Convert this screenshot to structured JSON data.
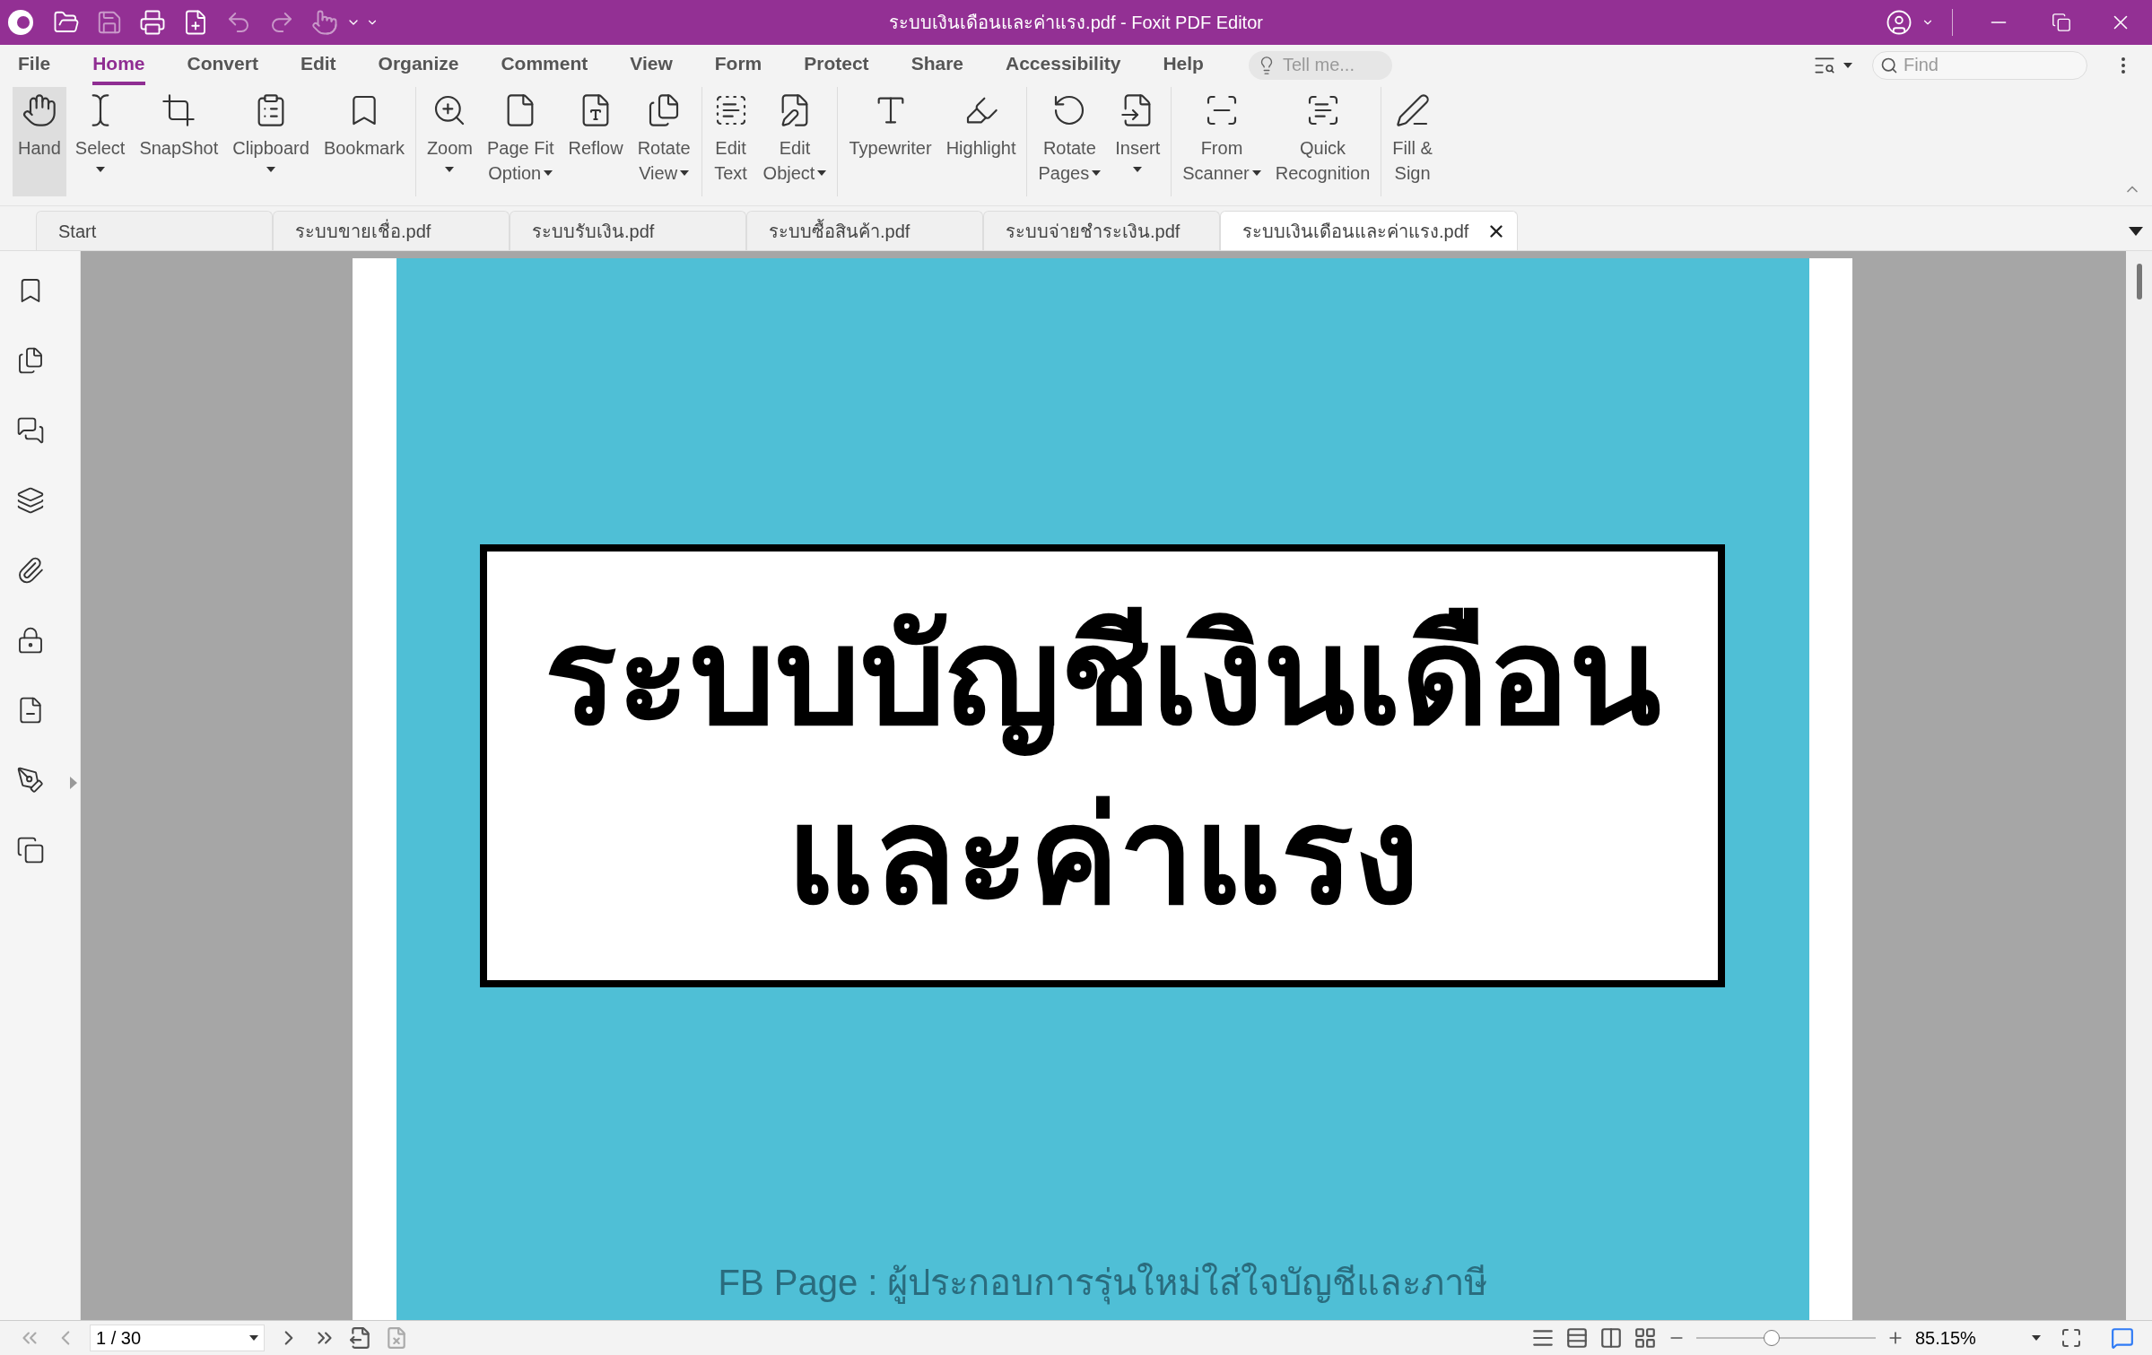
{
  "window": {
    "title": "ระบบเงินเดือนและค่าแรง.pdf - Foxit PDF Editor"
  },
  "menu": [
    {
      "label": "File",
      "selected": false
    },
    {
      "label": "Home",
      "selected": true
    },
    {
      "label": "Convert",
      "selected": false
    },
    {
      "label": "Edit",
      "selected": false
    },
    {
      "label": "Organize",
      "selected": false
    },
    {
      "label": "Comment",
      "selected": false
    },
    {
      "label": "View",
      "selected": false
    },
    {
      "label": "Form",
      "selected": false
    },
    {
      "label": "Protect",
      "selected": false
    },
    {
      "label": "Share",
      "selected": false
    },
    {
      "label": "Accessibility",
      "selected": false
    },
    {
      "label": "Help",
      "selected": false
    }
  ],
  "tell_me": {
    "placeholder": "Tell me..."
  },
  "find": {
    "placeholder": "Find"
  },
  "ribbon": [
    [
      {
        "lines": [
          "Hand"
        ],
        "dropdown": false,
        "selected": true
      },
      {
        "lines": [
          "Select"
        ],
        "dropdown": true,
        "selected": false
      },
      {
        "lines": [
          "SnapShot"
        ],
        "dropdown": false,
        "selected": false
      },
      {
        "lines": [
          "Clipboard"
        ],
        "dropdown": true,
        "selected": false
      },
      {
        "lines": [
          "Bookmark"
        ],
        "dropdown": false,
        "selected": false
      }
    ],
    [
      {
        "lines": [
          "Zoom"
        ],
        "dropdown": true,
        "selected": false
      },
      {
        "lines": [
          "Page Fit",
          "Option"
        ],
        "dropdown": true,
        "selected": false
      },
      {
        "lines": [
          "Reflow"
        ],
        "dropdown": false,
        "selected": false
      },
      {
        "lines": [
          "Rotate",
          "View"
        ],
        "dropdown": true,
        "selected": false
      }
    ],
    [
      {
        "lines": [
          "Edit",
          "Text"
        ],
        "dropdown": false,
        "selected": false
      },
      {
        "lines": [
          "Edit",
          "Object"
        ],
        "dropdown": true,
        "selected": false
      }
    ],
    [
      {
        "lines": [
          "Typewriter"
        ],
        "dropdown": false,
        "selected": false
      },
      {
        "lines": [
          "Highlight"
        ],
        "dropdown": false,
        "selected": false
      }
    ],
    [
      {
        "lines": [
          "Rotate",
          "Pages"
        ],
        "dropdown": true,
        "selected": false
      },
      {
        "lines": [
          "Insert"
        ],
        "dropdown": true,
        "selected": false
      }
    ],
    [
      {
        "lines": [
          "From",
          "Scanner"
        ],
        "dropdown": true,
        "selected": false
      },
      {
        "lines": [
          "Quick",
          "Recognition"
        ],
        "dropdown": false,
        "selected": false
      }
    ],
    [
      {
        "lines": [
          "Fill &",
          "Sign"
        ],
        "dropdown": false,
        "selected": false
      }
    ]
  ],
  "doc_tabs": [
    {
      "label": "Start",
      "selected": false
    },
    {
      "label": "ระบบขายเชื่อ.pdf",
      "selected": false
    },
    {
      "label": "ระบบรับเงิน.pdf",
      "selected": false
    },
    {
      "label": "ระบบซื้อสินค้า.pdf",
      "selected": false
    },
    {
      "label": "ระบบจ่ายชำระเงิน.pdf",
      "selected": false
    },
    {
      "label": "ระบบเงินเดือนและค่าแรง.pdf",
      "selected": true
    }
  ],
  "document": {
    "heading": [
      "ระบบบัญชีเงินเดือน",
      "และค่าแรง"
    ],
    "footer": "FB Page : ผู้ประกอบการรุ่นใหม่ใส่ใจบัญชีและภาษี"
  },
  "status_bar": {
    "page": "1 / 30",
    "zoom": "85.15%",
    "zoom_slider": {
      "level": 0.42
    }
  }
}
